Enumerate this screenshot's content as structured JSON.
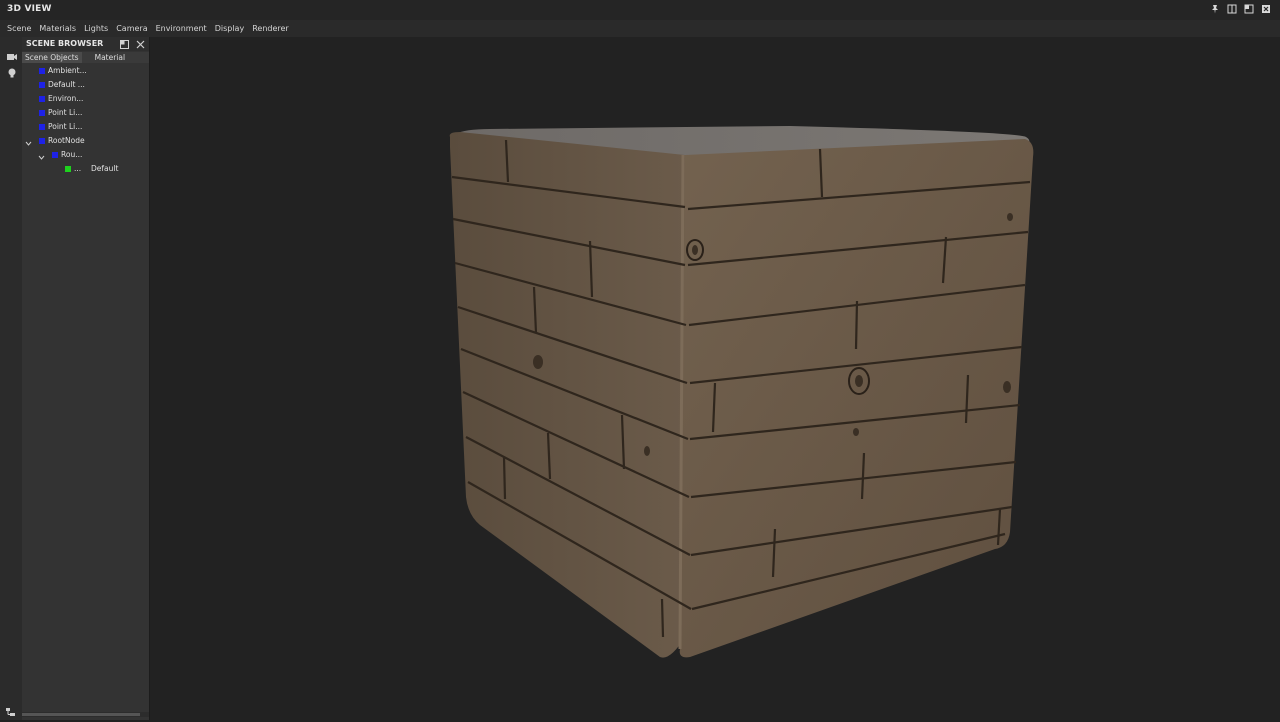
{
  "window": {
    "title": "3D VIEW"
  },
  "menu": [
    "Scene",
    "Materials",
    "Lights",
    "Camera",
    "Environment",
    "Display",
    "Renderer"
  ],
  "panel": {
    "title": "SCENE BROWSER",
    "tabs": [
      "Scene Objects",
      "Material"
    ],
    "tree": [
      {
        "label": "Ambient...",
        "color": "#1e22e6"
      },
      {
        "label": "Default ...",
        "color": "#1e22e6"
      },
      {
        "label": "Environ...",
        "color": "#1e22e6"
      },
      {
        "label": "Point Li...",
        "color": "#1e22e6"
      },
      {
        "label": "Point Li...",
        "color": "#1e22e6"
      },
      {
        "label": "RootNode",
        "color": "#1e22e6",
        "expanded": true
      },
      {
        "label": "Rou...",
        "color": "#1e22e6",
        "expanded": true
      },
      {
        "label": "...",
        "color": "#1ed21e",
        "material": "Default"
      }
    ]
  },
  "colors": {
    "background": "#222222",
    "panel": "#333333",
    "accent_blue": "#1e22e6",
    "accent_green": "#1ed21e"
  },
  "icons": {
    "pin": "pin-icon",
    "tile": "tile-icon",
    "maximize": "maximize-icon",
    "close": "close-icon",
    "camera": "camera-icon",
    "light": "lightbulb-icon",
    "hierarchy": "hierarchy-icon"
  }
}
